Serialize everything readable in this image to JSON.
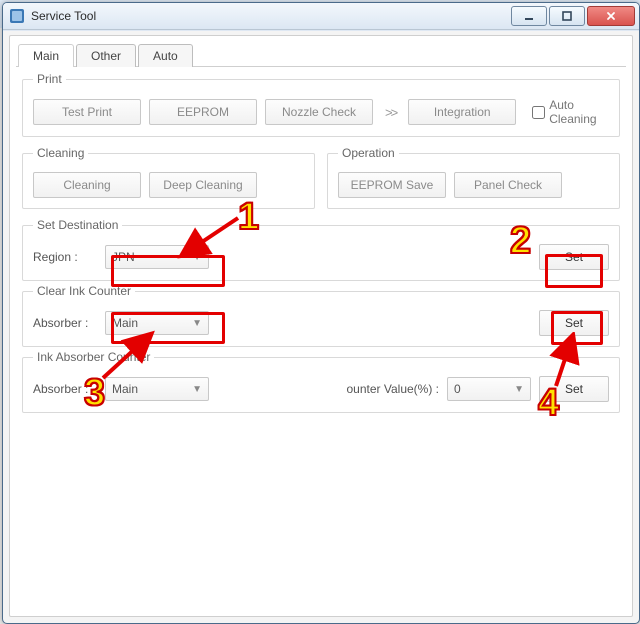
{
  "window": {
    "title": "Service Tool"
  },
  "tabs": {
    "main": "Main",
    "other": "Other",
    "auto": "Auto"
  },
  "print": {
    "legend": "Print",
    "test_print": "Test Print",
    "eeprom": "EEPROM",
    "nozzle_check": "Nozzle Check",
    "integration": "Integration",
    "auto_cleaning": "Auto Cleaning"
  },
  "cleaning": {
    "legend": "Cleaning",
    "cleaning": "Cleaning",
    "deep_cleaning": "Deep Cleaning"
  },
  "operation": {
    "legend": "Operation",
    "eeprom_save": "EEPROM Save",
    "panel_check": "Panel Check"
  },
  "set_destination": {
    "legend": "Set Destination",
    "region_label": "Region :",
    "region_value": "JPN",
    "set": "Set"
  },
  "clear_ink": {
    "legend": "Clear Ink Counter",
    "absorber_label": "Absorber :",
    "absorber_value": "Main",
    "set": "Set"
  },
  "ink_absorber": {
    "legend": "Ink Absorber Counter",
    "absorber_label": "Absorber :",
    "absorber_value": "Main",
    "counter_label": "ounter Value(%) :",
    "counter_value": "0",
    "set": "Set"
  },
  "annotations": {
    "n1": "1",
    "n2": "2",
    "n3": "3",
    "n4": "4"
  }
}
